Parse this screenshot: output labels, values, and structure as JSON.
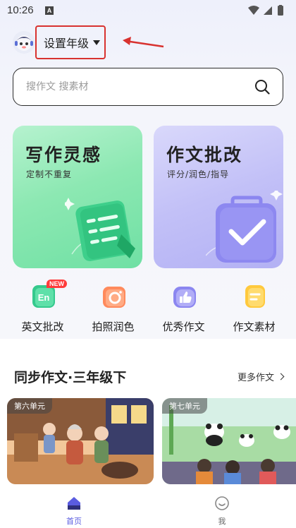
{
  "status_bar": {
    "time": "10:26",
    "notification_letter": "A"
  },
  "header": {
    "grade_label": "设置年级"
  },
  "search": {
    "placeholder": "搜作文 搜素材"
  },
  "cards": [
    {
      "title": "写作灵感",
      "subtitle": "定制不重复",
      "color": "#7ee6ad"
    },
    {
      "title": "作文批改",
      "subtitle": "评分/润色/指导",
      "color": "#bebcf6"
    }
  ],
  "quick_actions": [
    {
      "label": "英文批改",
      "icon": "en-icon",
      "badge": "NEW"
    },
    {
      "label": "拍照润色",
      "icon": "camera-icon"
    },
    {
      "label": "优秀作文",
      "icon": "thumbs-up-icon"
    },
    {
      "label": "作文素材",
      "icon": "document-icon"
    }
  ],
  "sync": {
    "title": "同步作文·三年级下",
    "more_label": "更多作文"
  },
  "units": [
    {
      "tag": "第六单元"
    },
    {
      "tag": "第七单元"
    }
  ],
  "tabbar": [
    {
      "label": "首页",
      "active": true
    },
    {
      "label": "我",
      "active": false
    }
  ],
  "colors": {
    "accent": "#5a5ce0",
    "annotation_red": "#d8322f"
  }
}
